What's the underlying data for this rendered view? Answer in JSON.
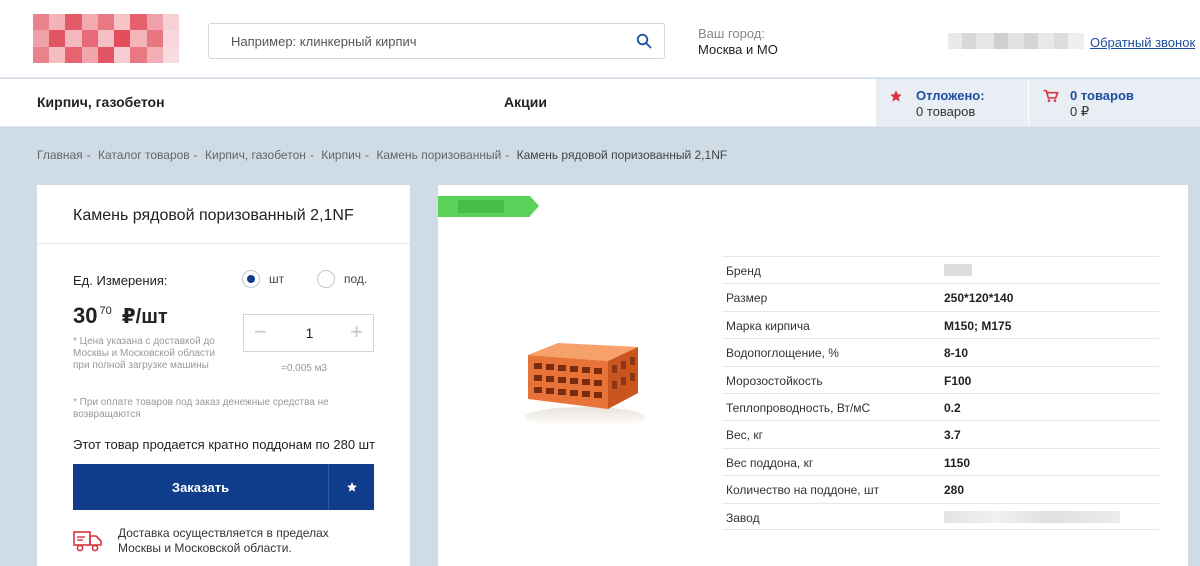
{
  "colors": {
    "brand_blue": "#0f3d8c",
    "link_blue": "#1c4fa0",
    "accent_red": "#d9343f",
    "tag_green": "#5ad35a",
    "page_bg": "#cfdbe5"
  },
  "header": {
    "search_placeholder": "Например: клинкерный кирпич",
    "city_label": "Ваш город:",
    "city_value": "Москва и МО",
    "callback_label": "Обратный звонок"
  },
  "nav": {
    "items": [
      "Кирпич, газобетон",
      "Акции"
    ],
    "deferred": {
      "title": "Отложено:",
      "value": "0 товаров"
    },
    "cart": {
      "title": "0 товаров",
      "value": "0 ₽"
    }
  },
  "breadcrumb": [
    "Главная",
    "Каталог товаров",
    "Кирпич, газобетон",
    "Кирпич",
    "Камень поризованный",
    "Камень рядовой поризованный 2,1NF"
  ],
  "product": {
    "title": "Камень рядовой поризованный 2,1NF",
    "unit_label": "Ед. Измерения:",
    "unit_options": [
      "шт",
      "под."
    ],
    "price_int": "30",
    "price_frac": "70",
    "price_unit": "₽/шт",
    "price_note": "* Цена указана с доставкой до Москвы и Московской области при полной загрузке машины",
    "quantity": "1",
    "volume": "=0.005 м3",
    "order_note": "* При оплате товаров под заказ денежные средства не возвращаются",
    "multiple_note": "Этот товар продается кратно поддонам по 280 шт",
    "order_button": "Заказать",
    "delivery_text": "Доставка осуществляется в пределах Москвы и Московской области."
  },
  "specs": [
    {
      "name": "Бренд",
      "value": ""
    },
    {
      "name": "Размер",
      "value": "250*120*140"
    },
    {
      "name": "Марка кирпича",
      "value": "М150; М175"
    },
    {
      "name": "Водопоглощение, %",
      "value": "8-10"
    },
    {
      "name": "Морозостойкость",
      "value": "F100"
    },
    {
      "name": "Теплопроводность, Вт/мС",
      "value": "0.2"
    },
    {
      "name": "Вес, кг",
      "value": "3.7"
    },
    {
      "name": "Вес поддона, кг",
      "value": "1150"
    },
    {
      "name": "Количество на поддоне, шт",
      "value": "280"
    },
    {
      "name": "Завод",
      "value": ""
    }
  ]
}
